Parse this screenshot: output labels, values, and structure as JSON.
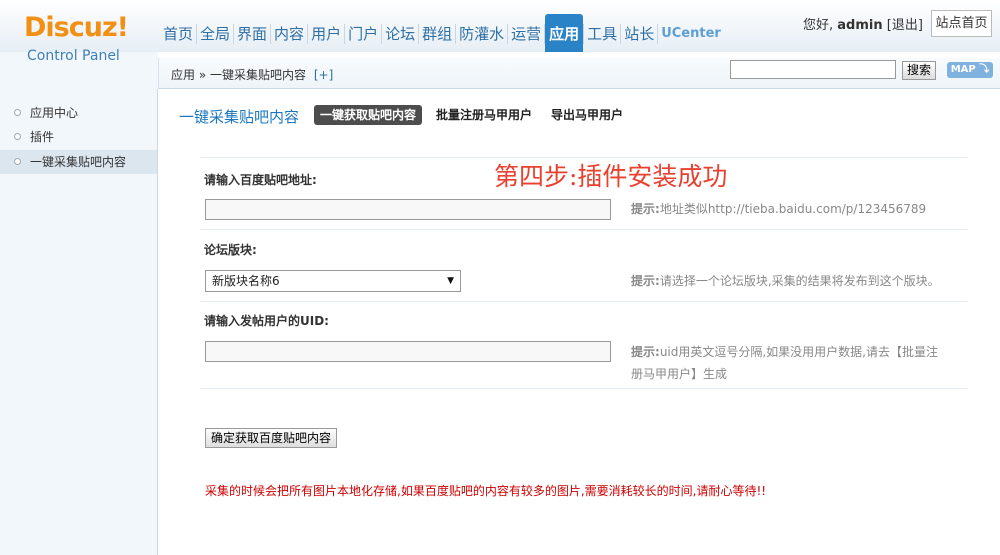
{
  "logo": {
    "brand": "Discuz!",
    "subtitle": "Control Panel"
  },
  "nav": [
    {
      "label": "首页"
    },
    {
      "label": "全局"
    },
    {
      "label": "界面"
    },
    {
      "label": "内容"
    },
    {
      "label": "用户"
    },
    {
      "label": "门户"
    },
    {
      "label": "论坛"
    },
    {
      "label": "群组"
    },
    {
      "label": "防灌水"
    },
    {
      "label": "运营"
    },
    {
      "label": "应用"
    },
    {
      "label": "工具"
    },
    {
      "label": "站长"
    },
    {
      "label": "UCenter"
    }
  ],
  "user": {
    "greeting": "您好,",
    "name": "admin",
    "logout": "[退出]",
    "site_home": "站点首页"
  },
  "breadcrumb": {
    "section": "应用",
    "sep": "»",
    "page": "一键采集贴吧内容",
    "add": "[+]"
  },
  "search": {
    "button": "搜索",
    "map": "MAP"
  },
  "sidebar": {
    "items": [
      {
        "label": "应用中心"
      },
      {
        "label": "插件"
      },
      {
        "label": "一键采集贴吧内容"
      }
    ]
  },
  "main": {
    "title": "一键采集贴吧内容",
    "tabs": [
      {
        "label": "一键获取贴吧内容"
      },
      {
        "label": "批量注册马甲用户"
      },
      {
        "label": "导出马甲用户"
      }
    ],
    "step_note": "第四步:插件安装成功",
    "fields": [
      {
        "label": "请输入百度贴吧地址:",
        "tip_prefix": "提示:",
        "tip": "地址类似http://tieba.baidu.com/p/123456789"
      },
      {
        "label": "论坛版块:",
        "selected": "新版块名称6",
        "tip_prefix": "提示:",
        "tip": "请选择一个论坛版块,采集的结果将发布到这个版块。"
      },
      {
        "label": "请输入发帖用户的UID:",
        "tip_prefix": "提示:",
        "tip": "uid用英文逗号分隔,如果没用用户数据,请去【批量注",
        "tip2": "册马甲用户】生成"
      }
    ],
    "submit": "确定获取百度贴吧内容",
    "warning": "采集的时候会把所有图片本地化存储,如果百度贴吧的内容有较多的图片,需要消耗较长的时间,请耐心等待!!"
  }
}
